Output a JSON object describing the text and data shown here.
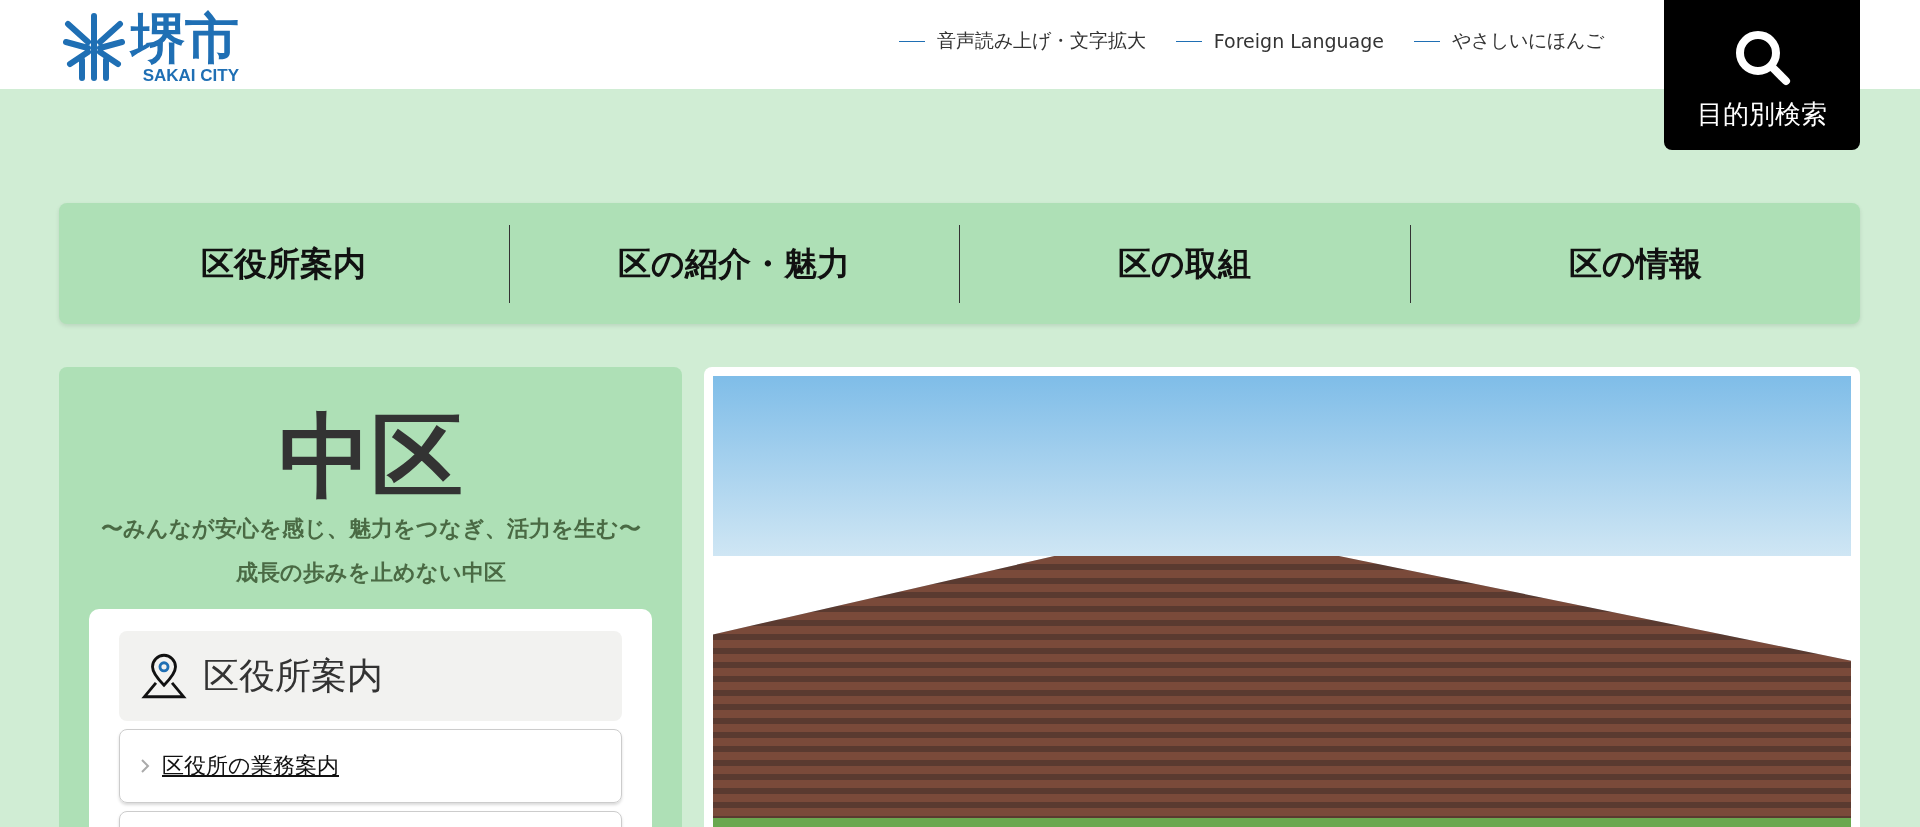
{
  "logo": {
    "title": "堺市",
    "subtitle": "SAKAI CITY"
  },
  "header_links": [
    "音声読み上げ・文字拡大",
    "Foreign Language",
    "やさしいにほんご"
  ],
  "search_button": {
    "label": "目的別検索"
  },
  "nav": [
    {
      "label": "区役所案内"
    },
    {
      "label": "区の紹介・魅力"
    },
    {
      "label": "区の取組"
    },
    {
      "label": "区の情報"
    }
  ],
  "ward": {
    "title": "中区",
    "tagline": [
      "〜みんなが安心を感じ、魅力をつなぎ、活力を生む〜",
      "成長の歩みを止めない中区"
    ]
  },
  "office_card": {
    "heading": "区役所案内",
    "links": [
      "区役所の業務案内"
    ]
  }
}
